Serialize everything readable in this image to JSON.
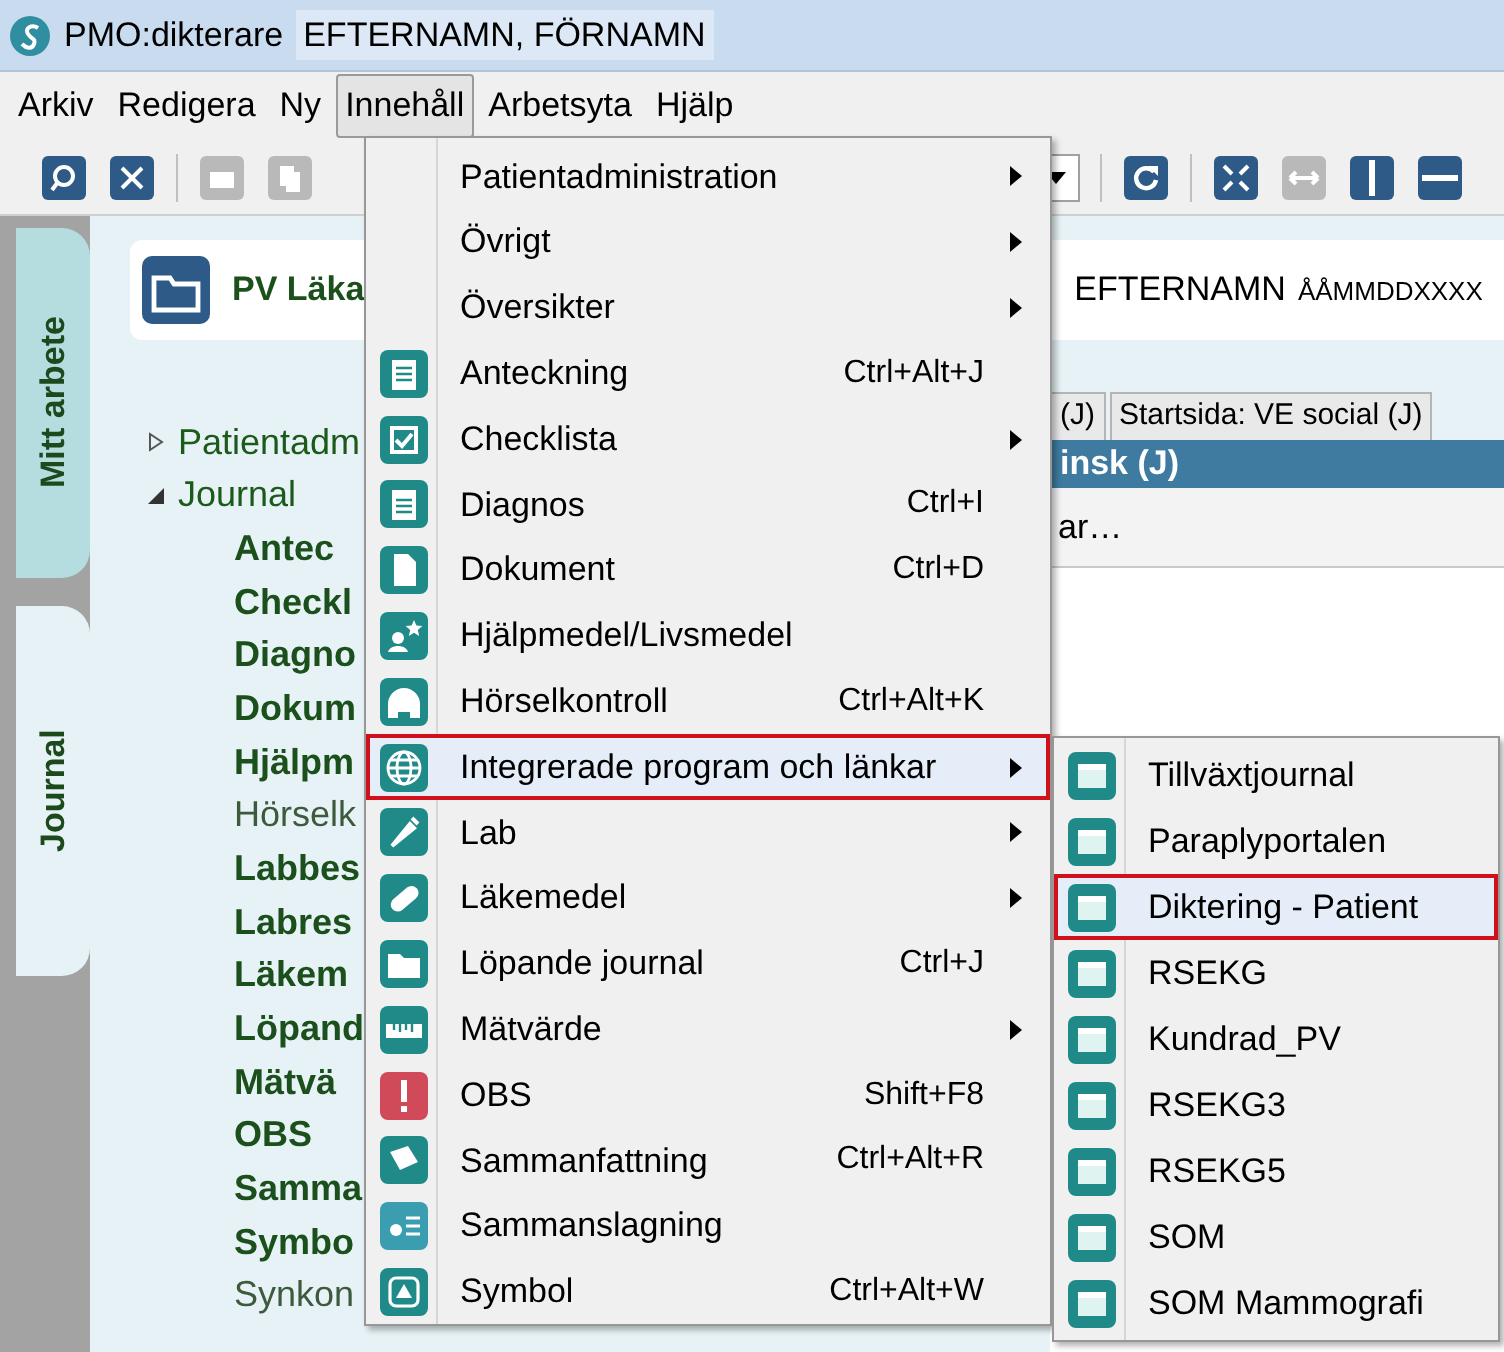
{
  "window": {
    "app": "PMO:dikterare",
    "patient": "EFTERNAMN, FÖRNAMN"
  },
  "menubar": [
    {
      "label": "Arkiv",
      "selected": false
    },
    {
      "label": "Redigera",
      "selected": false
    },
    {
      "label": "Ny",
      "selected": false
    },
    {
      "label": "Innehåll",
      "selected": true
    },
    {
      "label": "Arbetsyta",
      "selected": false
    },
    {
      "label": "Hjälp",
      "selected": false
    }
  ],
  "side_tabs": [
    {
      "label": "Mitt arbete",
      "selected": false
    },
    {
      "label": "Journal",
      "selected": true
    }
  ],
  "header": {
    "title": "PV Läka",
    "patient_name": "EFTERNAMN",
    "patient_id": "ÅÅMMDDXXXX"
  },
  "tree": [
    {
      "label": "Patientadm",
      "expanded": false
    },
    {
      "label": "Journal",
      "expanded": true,
      "children": [
        {
          "label": "Antec",
          "bold": true
        },
        {
          "label": "Checkl",
          "bold": true
        },
        {
          "label": "Diagno",
          "bold": true
        },
        {
          "label": "Dokum",
          "bold": true
        },
        {
          "label": "Hjälpm",
          "bold": true
        },
        {
          "label": "Hörselk",
          "bold": false
        },
        {
          "label": "Labbes",
          "bold": true
        },
        {
          "label": "Labres",
          "bold": true
        },
        {
          "label": "Läkem",
          "bold": true
        },
        {
          "label": "Löpand",
          "bold": true
        },
        {
          "label": "Mätvä",
          "bold": true
        },
        {
          "label": "OBS",
          "bold": true
        },
        {
          "label": "Samma",
          "bold": true
        },
        {
          "label": "Symbo",
          "bold": true
        },
        {
          "label": "Synkon",
          "bold": false
        }
      ]
    }
  ],
  "doc_tabs": [
    {
      "label": "(J)",
      "selected": false
    },
    {
      "label": "Startsida: VE social (J)",
      "selected": false
    }
  ],
  "panel": {
    "title": "insk (J)",
    "text": "ar…"
  },
  "menu": [
    {
      "label": "Patientadministration",
      "submenu": true,
      "selected": false
    },
    {
      "label": "Övrigt",
      "submenu": true,
      "selected": false
    },
    {
      "label": "Översikter",
      "submenu": true,
      "selected": false
    },
    {
      "label": "Anteckning",
      "shortcut": "Ctrl+Alt+J",
      "submenu": false,
      "selected": false
    },
    {
      "label": "Checklista",
      "submenu": true,
      "selected": false
    },
    {
      "label": "Diagnos",
      "shortcut": "Ctrl+I",
      "submenu": false,
      "selected": false
    },
    {
      "label": "Dokument",
      "shortcut": "Ctrl+D",
      "submenu": false,
      "selected": false
    },
    {
      "label": "Hjälpmedel/Livsmedel",
      "submenu": false,
      "selected": false
    },
    {
      "label": "Hörselkontroll",
      "shortcut": "Ctrl+Alt+K",
      "submenu": false,
      "selected": false
    },
    {
      "label": "Integrerade program och länkar",
      "submenu": true,
      "selected": true
    },
    {
      "label": "Lab",
      "submenu": true,
      "selected": false
    },
    {
      "label": "Läkemedel",
      "submenu": true,
      "selected": false
    },
    {
      "label": "Löpande journal",
      "shortcut": "Ctrl+J",
      "submenu": false,
      "selected": false
    },
    {
      "label": "Mätvärde",
      "submenu": true,
      "selected": false
    },
    {
      "label": "OBS",
      "shortcut": "Shift+F8",
      "submenu": false,
      "selected": false
    },
    {
      "label": "Sammanfattning",
      "shortcut": "Ctrl+Alt+R",
      "submenu": false,
      "selected": false
    },
    {
      "label": "Sammanslagning",
      "submenu": false,
      "selected": false
    },
    {
      "label": "Symbol",
      "shortcut": "Ctrl+Alt+W",
      "submenu": false,
      "selected": false
    }
  ],
  "submenu": [
    {
      "label": "Tillväxtjournal",
      "selected": false
    },
    {
      "label": "Paraplyportalen",
      "selected": false
    },
    {
      "label": "Diktering - Patient",
      "selected": true
    },
    {
      "label": "RSEKG",
      "selected": false
    },
    {
      "label": "Kundrad_PV",
      "selected": false
    },
    {
      "label": "RSEKG3",
      "selected": false
    },
    {
      "label": "RSEKG5",
      "selected": false
    },
    {
      "label": "SOM",
      "selected": false
    },
    {
      "label": "SOM Mammografi",
      "selected": false
    }
  ]
}
